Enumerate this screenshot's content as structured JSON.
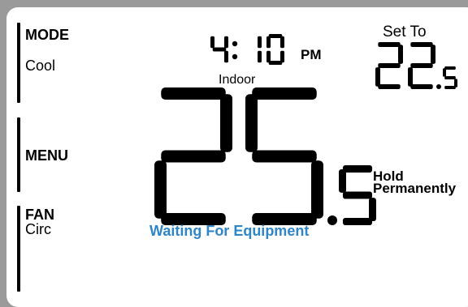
{
  "mode": {
    "label": "MODE",
    "value": "Cool"
  },
  "menu": {
    "label": "MENU"
  },
  "fan": {
    "label": "FAN",
    "value": "Circ"
  },
  "clock": {
    "time": "4:10",
    "ampm": "PM"
  },
  "setpoint": {
    "label": "Set To",
    "value": "22",
    "decimal": "5"
  },
  "indoor": {
    "label": "Indoor",
    "value": "25",
    "decimal": "5"
  },
  "hold": {
    "line1": "Hold",
    "line2": "Permanently"
  },
  "status": {
    "text": "Waiting For Equipment",
    "color": "#2e86c8"
  }
}
